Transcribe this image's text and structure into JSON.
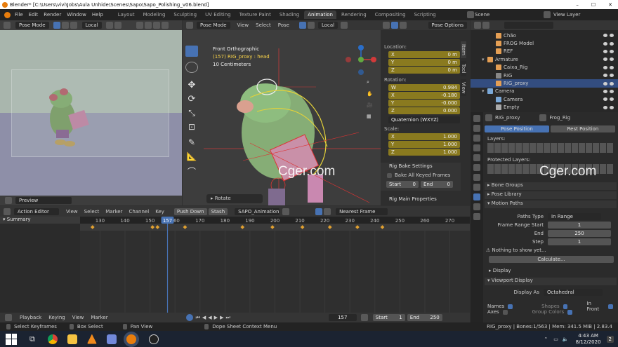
{
  "window": {
    "title": "Blender* [C:\\Users\\vivi\\Jobs\\Aula Unhide\\Scenes\\Sapo\\Sapo_Polishing_v06.blend]"
  },
  "menu": [
    "File",
    "Edit",
    "Render",
    "Window",
    "Help"
  ],
  "workspaces": [
    "Layout",
    "Modeling",
    "Sculpting",
    "UV Editing",
    "Texture Paint",
    "Shading",
    "Animation",
    "Rendering",
    "Compositing",
    "Scripting"
  ],
  "active_workspace": "Animation",
  "scene": {
    "name": "Scene",
    "layer": "View Layer"
  },
  "left_viewport": {
    "mode": "Pose Mode",
    "orient": "Local",
    "footer": "Preview"
  },
  "main_viewport": {
    "mode": "Pose Mode",
    "menus": [
      "View",
      "Select",
      "Pose"
    ],
    "orient": "Local",
    "pose_options": "Pose Options",
    "overlay": [
      "Front Orthographic",
      "(157) RIG_proxy : head",
      "10 Centimeters"
    ],
    "op_panel": "Rotate"
  },
  "npanel": {
    "tabs": [
      "Item",
      "Tool",
      "View"
    ],
    "location_label": "Location:",
    "location": [
      {
        "axis": "X",
        "value": "0 m"
      },
      {
        "axis": "Y",
        "value": "0 m"
      },
      {
        "axis": "Z",
        "value": "0 m"
      }
    ],
    "rotation_label": "Rotation:",
    "rotation": [
      {
        "axis": "W",
        "value": "0.984"
      },
      {
        "axis": "X",
        "value": "-0.180"
      },
      {
        "axis": "Y",
        "value": "-0.000"
      },
      {
        "axis": "Z",
        "value": "0.000"
      }
    ],
    "rotation_mode": "Quaternion (WXYZ)",
    "scale_label": "Scale:",
    "scale": [
      {
        "axis": "X",
        "value": "1.000"
      },
      {
        "axis": "Y",
        "value": "1.000"
      },
      {
        "axis": "Z",
        "value": "1.000"
      }
    ],
    "bake_title": "Rig Bake Settings",
    "bake_keyed": "Bake All Keyed Frames",
    "start_label": "Start",
    "start_val": "0",
    "end_label": "End",
    "end_val": "0",
    "main_props": "Rig Main Properties"
  },
  "outliner": [
    {
      "name": "Chão",
      "indent": 2,
      "color": "#e59f54"
    },
    {
      "name": "FROG Model",
      "indent": 2,
      "color": "#e59f54"
    },
    {
      "name": "REF",
      "indent": 2,
      "color": "#e59f54"
    },
    {
      "name": "Armature",
      "indent": 1,
      "color": "#e59f54"
    },
    {
      "name": "Caixa_Rig",
      "indent": 2,
      "color": "#e59f54"
    },
    {
      "name": "RIG",
      "indent": 2,
      "color": "#888888"
    },
    {
      "name": "RIG_proxy",
      "indent": 2,
      "color": "#e59f54"
    },
    {
      "name": "Camera",
      "indent": 1,
      "color": "#7aa8d8"
    },
    {
      "name": "Camera",
      "indent": 2,
      "color": "#7aa8d8"
    },
    {
      "name": "Empty",
      "indent": 2,
      "color": "#aaaaaa"
    }
  ],
  "properties": {
    "obj": "RIG_proxy",
    "data": "Frog_Rig",
    "pose_position": "Pose Position",
    "rest_position": "Rest Position",
    "layers": "Layers:",
    "protected": "Protected Layers:",
    "bone_groups": "Bone Groups",
    "pose_library": "Pose Library",
    "motion_paths": "Motion Paths",
    "paths_type_label": "Paths Type",
    "paths_type": "In Range",
    "frame_start_label": "Frame Range Start",
    "frame_start": "1",
    "end_label": "End",
    "end": "250",
    "step_label": "Step",
    "step": "1",
    "nothing": "Nothing to show yet...",
    "calculate": "Calculate...",
    "display": "Display",
    "viewport_display": "Viewport Display",
    "display_as_label": "Display As",
    "display_as": "Octahedral",
    "names": "Names",
    "shapes": "Shapes",
    "in_front": "In Front",
    "axes": "Axes",
    "group_colors": "Group Colors"
  },
  "timeline": {
    "editor": "Action Editor",
    "menus": [
      "View",
      "Select",
      "Marker",
      "Channel",
      "Key"
    ],
    "push_down": "Push Down",
    "stash": "Stash",
    "action": "SAPO_Animation",
    "snap": "Nearest Frame",
    "current_frame": 157,
    "ticks": [
      130,
      140,
      150,
      160,
      170,
      180,
      190,
      200,
      210,
      220,
      230,
      240,
      250,
      260,
      270
    ],
    "range_min": 122,
    "range_max": 278,
    "keyframes": [
      127,
      151,
      153,
      164,
      187,
      199,
      211,
      222,
      233,
      243
    ],
    "summary": "Summary"
  },
  "playback": {
    "menus": [
      "Playback",
      "Keying",
      "View",
      "Marker"
    ],
    "frame": "157",
    "start_label": "Start",
    "start": "1",
    "end_label": "End",
    "end": "250"
  },
  "status": {
    "select_keys": "Select Keyframes",
    "box_select": "Box Select",
    "pan": "Pan View",
    "context": "Dope Sheet Context Menu",
    "stats": "RIG_proxy | Bones:1/563 | Mem: 341.5 MiB | 2.83.4"
  },
  "taskbar": {
    "time": "4:43 AM",
    "date": "8/12/2020",
    "notif": "2"
  },
  "watermarks": [
    "Cger.com",
    "Cger.com"
  ],
  "colors": {
    "accent": "#4772b3",
    "field_gold": "#8a7a1f",
    "timeline_cursor": "#4772b3"
  }
}
